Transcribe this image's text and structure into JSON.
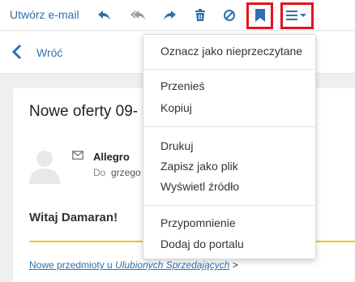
{
  "toolbar": {
    "compose_label": "Utwórz e-mail",
    "icons": [
      "reply-icon",
      "reply-all-icon",
      "forward-icon",
      "trash-icon",
      "block-icon",
      "bookmark-icon",
      "menu-icon"
    ],
    "highlight_color": "#e4131c",
    "accent_color": "#2f6fad"
  },
  "nav": {
    "back_label": "Wróć"
  },
  "message": {
    "subject": "Nowe oferty 09-",
    "sender": "Allegro",
    "to_label": "Do",
    "to_value": "grzego",
    "greeting": "Witaj Damaran!",
    "footer_link_prefix": "Nowe przedmioty u ",
    "footer_link_italic": "Ulubionych Sprzedających",
    "footer_suffix": " >"
  },
  "menu": {
    "items": [
      {
        "label": "Oznacz jako nieprzeczytane"
      },
      {
        "label": "Przenieś"
      },
      {
        "label": "Kopiuj"
      },
      {
        "label": "Drukuj"
      },
      {
        "label": "Zapisz jako plik"
      },
      {
        "label": "Wyświetl źródło"
      },
      {
        "label": "Przypomnienie"
      },
      {
        "label": "Dodaj do portalu"
      }
    ]
  }
}
